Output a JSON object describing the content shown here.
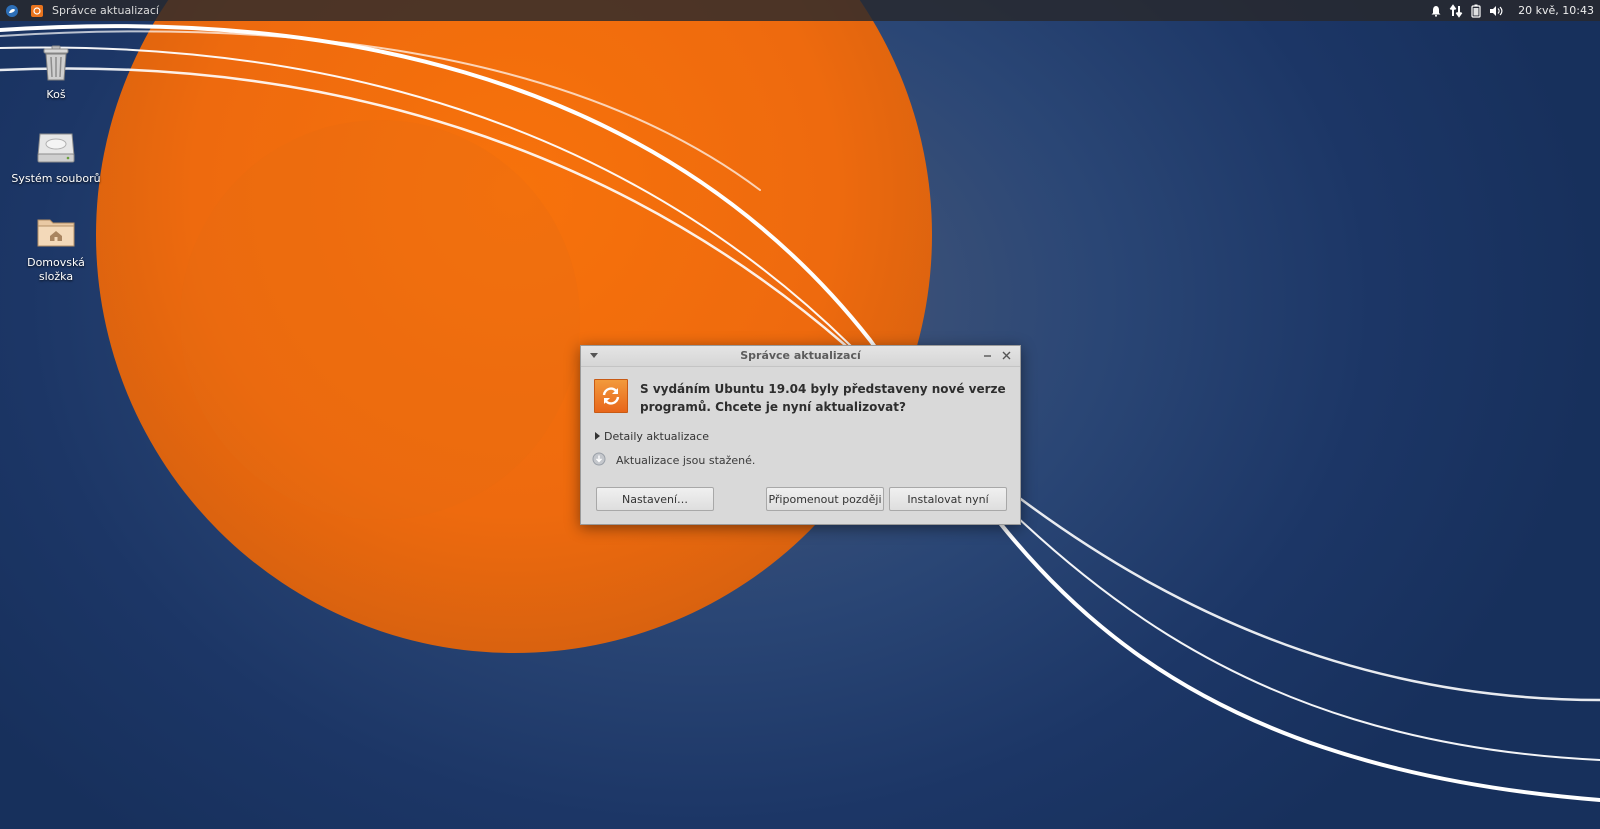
{
  "panel": {
    "task_title": "Správce aktualizací",
    "clock": "20 kvě, 10:43"
  },
  "desktop_icons": [
    {
      "label": "Koš",
      "icon": "trash-icon"
    },
    {
      "label": "Systém souborů",
      "icon": "drive-icon"
    },
    {
      "label": "Domovská složka",
      "icon": "home-folder-icon"
    }
  ],
  "dialog": {
    "title": "Správce aktualizací",
    "message": "S vydáním Ubuntu 19.04 byly představeny nové verze programů. Chcete je nyní aktualizovat?",
    "details_label": "Detaily aktualizace",
    "status": "Aktualizace jsou stažené.",
    "buttons": {
      "settings": "Nastavení…",
      "remind_later": "Připomenout později",
      "install_now": "Instalovat nyní"
    }
  },
  "colors": {
    "accent_orange": "#e9731d",
    "desktop_blue": "#1c3666",
    "dialog_bg": "#d9d9d9"
  }
}
